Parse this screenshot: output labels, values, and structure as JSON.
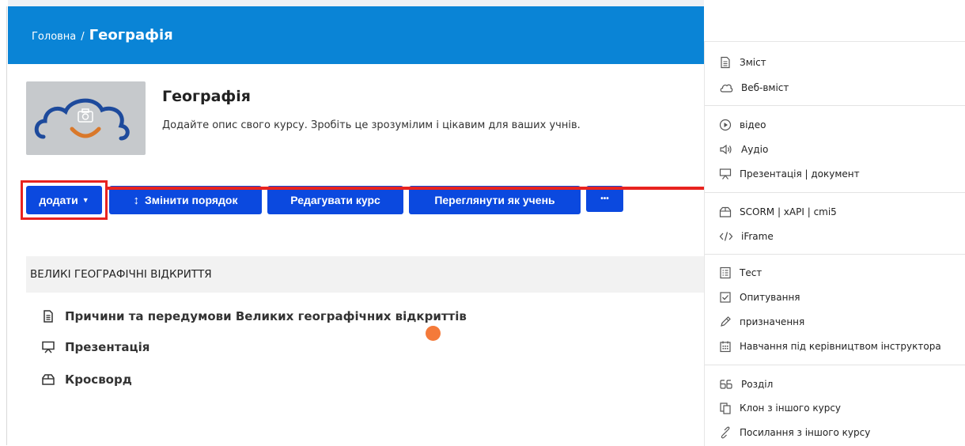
{
  "breadcrumb": {
    "home": "Головна",
    "separator": "/",
    "current": "Географія"
  },
  "course": {
    "title": "Географія",
    "description": "Додайте опис свого курсу. Зробіть це зрозумілим і цікавим для ваших учнів.",
    "thumbnail_icons": [
      "cloud-icon",
      "camera-icon"
    ]
  },
  "toolbar": {
    "add_label": "додати",
    "reorder_label": "Змінити порядок",
    "edit_label": "Редагувати курс",
    "preview_label": "Переглянути як учень",
    "more_label": "•••"
  },
  "section": {
    "title": "ВЕЛИКІ ГЕОГРАФІЧНІ ВІДКРИТТЯ",
    "items": [
      {
        "label": "Причини та передумови Великих географічних відкриттів",
        "icon": "document-icon"
      },
      {
        "label": "Презентація",
        "icon": "presentation-icon"
      },
      {
        "label": "Кросворд",
        "icon": "package-icon"
      }
    ]
  },
  "add_menu": {
    "items": [
      {
        "label": "Зміст",
        "icon": "document-icon"
      },
      {
        "label": "Веб-вміст",
        "icon": "cloud-icon"
      },
      {
        "label": "відео",
        "icon": "play-icon"
      },
      {
        "label": "Аудіо",
        "icon": "speaker-icon"
      },
      {
        "label": "Презентація | документ",
        "icon": "presentation-icon"
      },
      {
        "label": "SCORM | xAPI | cmi5",
        "icon": "package-icon"
      },
      {
        "label": "iFrame",
        "icon": "code-icon"
      },
      {
        "label": "Тест",
        "icon": "list-icon"
      },
      {
        "label": "Опитування",
        "icon": "checkbox-icon"
      },
      {
        "label": "призначення",
        "icon": "pen-icon"
      },
      {
        "label": "Навчання під керівництвом інструктора",
        "icon": "calendar-icon"
      },
      {
        "label": "Розділ",
        "icon": "section-icon"
      },
      {
        "label": "Клон з іншого курсу",
        "icon": "copy-icon"
      },
      {
        "label": "Посилання з іншого курсу",
        "icon": "link-icon"
      }
    ]
  },
  "colors": {
    "header": "#0a84d6",
    "button": "#0b49df",
    "annotation": "#e8231f",
    "pointer_dot": "#f47a3a",
    "section_bg": "#f2f2f2"
  }
}
